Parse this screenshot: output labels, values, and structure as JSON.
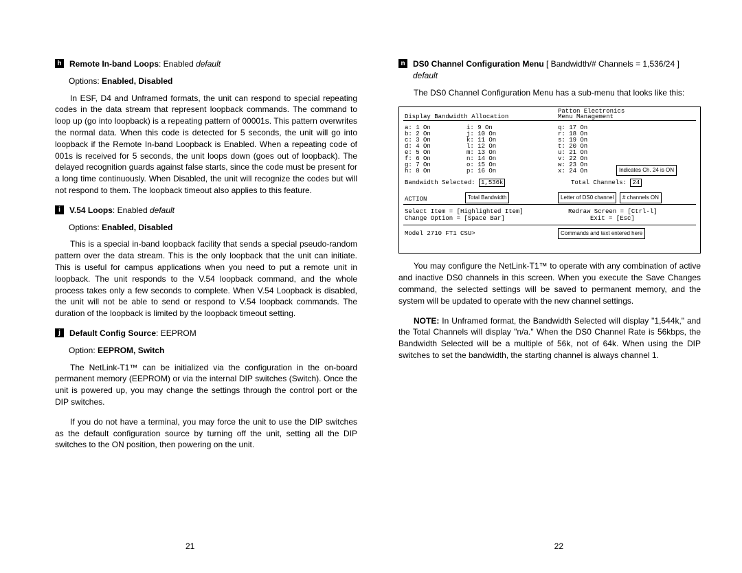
{
  "left": {
    "h": {
      "box": "h",
      "title": "Remote In-band Loops",
      "val": ": Enabled",
      "def": "default",
      "opts": "Options: ",
      "optb": "Enabled, Disabled",
      "para": "In ESF, D4 and Unframed formats, the unit can respond to special repeating codes in the data stream that represent loopback commands. The command to loop up (go into loopback) is a repeating pattern of 00001s. This pattern overwrites the normal data. When this code is detected for 5 seconds, the unit will go into loopback if the Remote In-band Loopback is Enabled. When a repeating code of 001s is received for 5 seconds, the unit loops down (goes out of loopback). The delayed recognition guards against false starts, since the code must be present for a long time continuously. When Disabled, the unit will recognize the codes but will not respond to them. The loopback timeout also applies to this feature."
    },
    "i": {
      "box": "i",
      "title": "V.54 Loops",
      "val": ": Enabled",
      "def": "default",
      "opts": "Options: ",
      "optb": "Enabled, Disabled",
      "para": "This is a special in-band loopback facility that sends a special pseudo-random pattern over the data stream. This is the only loopback that the unit can initiate. This is useful for campus applications when you need to put a remote unit in loopback. The unit responds to the V.54 loopback command, and the whole process takes only a few seconds to complete. When V.54 Loopback is disabled, the unit will not be able to send or respond to V.54 loopback commands. The duration of the loopback is limited by the loopback timeout setting."
    },
    "j": {
      "box": "j",
      "title": "Default Config Source",
      "val": ": EEPROM",
      "opts": "Option: ",
      "optb": "EEPROM, Switch",
      "para1": "The NetLink-T1™ can be initialized via the configuration in the on-board permanent memory (EEPROM) or via the internal DIP switches (Switch). Once the unit is powered up, you may change the settings through the control port or the DIP switches.",
      "para2": "If you do not have a terminal, you may force the unit to use the DIP switches as the default configuration source by turning off the unit, setting all the DIP switches to the ON position, then powering on the unit."
    },
    "pg": "21"
  },
  "right": {
    "n": {
      "box": "n",
      "title": "DS0 Channel Configuration Menu",
      "val": " [ Bandwidth/# Channels = 1,536/24 ]",
      "def": "default"
    },
    "intro": "The DS0 Channel Configuration Menu has a sub-menu that looks like this:",
    "menu": {
      "h1": "Display Bandwidth Allocation",
      "h2": "Patton Electronics",
      "h3": "Menu Management",
      "c1": [
        [
          "a:",
          "1",
          "On"
        ],
        [
          "b:",
          "2",
          "On"
        ],
        [
          "c:",
          "3",
          "On"
        ],
        [
          "d:",
          "4",
          "On"
        ],
        [
          "e:",
          "5",
          "On"
        ],
        [
          "f:",
          "6",
          "On"
        ],
        [
          "g:",
          "7",
          "On"
        ],
        [
          "h:",
          "8",
          "On"
        ]
      ],
      "c2": [
        [
          "i:",
          "9",
          "On"
        ],
        [
          "j:",
          "10",
          "On"
        ],
        [
          "k:",
          "11",
          "On"
        ],
        [
          "l:",
          "12",
          "On"
        ],
        [
          "m:",
          "13",
          "On"
        ],
        [
          "n:",
          "14",
          "On"
        ],
        [
          "o:",
          "15",
          "On"
        ],
        [
          "p:",
          "16",
          "On"
        ]
      ],
      "c3": [
        [
          "q:",
          "17",
          "On"
        ],
        [
          "r:",
          "18",
          "On"
        ],
        [
          "s:",
          "19",
          "On"
        ],
        [
          "t:",
          "20",
          "On"
        ],
        [
          "u:",
          "21",
          "On"
        ],
        [
          "v:",
          "22",
          "On"
        ],
        [
          "w:",
          "23",
          "On"
        ],
        [
          "x:",
          "24",
          "On"
        ]
      ],
      "bw": "Bandwidth Selected:",
      "bwv": "1,536k",
      "tc": "Total Channels:",
      "tcv": "24",
      "act": "ACTION",
      "sel": "Select Item = [Highlighted Item]",
      "chg": "Change Option = [Space Bar]",
      "red": "Redraw Screen = [Ctrl-l]",
      "exit": "Exit = [Esc]",
      "model": "Model 2710 FT1 CSU>",
      "lab1": "Indicates Ch. 24 is ON",
      "lab2": "# channels ON",
      "lab3": "Letter of DS0 channel",
      "lab4": "Total Bandwidth",
      "lab5": "Commands and text entered here"
    },
    "p1": "You may configure the NetLink-T1™ to operate with any combination of active and inactive DS0 channels in this screen. When you execute the Save Changes command, the selected settings will be saved to permanent memory, and the system will be updated to operate with the new channel settings.",
    "note": "NOTE:",
    "p2": " In Unframed format, the Bandwidth Selected will display \"1,544k,\" and the Total Channels will display \"n/a.\" When the DS0 Channel Rate is 56kbps, the Bandwidth Selected will be a multiple of 56k, not of 64k. When using the DIP switches to set the bandwidth, the starting channel is always channel 1.",
    "pg": "22"
  }
}
